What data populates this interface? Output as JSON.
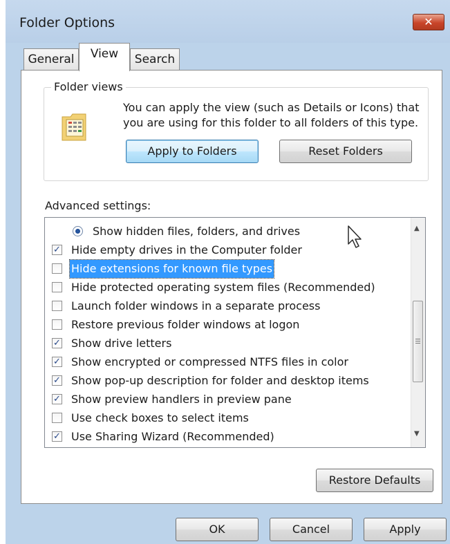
{
  "window": {
    "title": "Folder Options",
    "close_glyph": "✕"
  },
  "tabs": [
    {
      "label": "General",
      "active": false
    },
    {
      "label": "View",
      "active": true
    },
    {
      "label": "Search",
      "active": false
    }
  ],
  "folder_views": {
    "legend": "Folder views",
    "description": "You can apply the view (such as Details or Icons) that you are using for this folder to all folders of this type.",
    "icon": "folder-view-icon",
    "apply_button": "Apply to Folders",
    "reset_button": "Reset Folders"
  },
  "advanced": {
    "label": "Advanced settings:",
    "items": [
      {
        "type": "radio",
        "checked": true,
        "label": "Show hidden files, folders, and drives"
      },
      {
        "type": "checkbox",
        "checked": true,
        "label": "Hide empty drives in the Computer folder"
      },
      {
        "type": "checkbox",
        "checked": false,
        "selected": true,
        "label": "Hide extensions for known file types"
      },
      {
        "type": "checkbox",
        "checked": false,
        "label": "Hide protected operating system files (Recommended)"
      },
      {
        "type": "checkbox",
        "checked": false,
        "label": "Launch folder windows in a separate process"
      },
      {
        "type": "checkbox",
        "checked": false,
        "label": "Restore previous folder windows at logon"
      },
      {
        "type": "checkbox",
        "checked": true,
        "label": "Show drive letters"
      },
      {
        "type": "checkbox",
        "checked": true,
        "label": "Show encrypted or compressed NTFS files in color"
      },
      {
        "type": "checkbox",
        "checked": true,
        "label": "Show pop-up description for folder and desktop items"
      },
      {
        "type": "checkbox",
        "checked": true,
        "label": "Show preview handlers in preview pane"
      },
      {
        "type": "checkbox",
        "checked": false,
        "label": "Use check boxes to select items"
      },
      {
        "type": "checkbox",
        "checked": true,
        "label": "Use Sharing Wizard (Recommended)"
      }
    ],
    "check_glyph": "✓",
    "restore_button": "Restore Defaults"
  },
  "footer": {
    "ok": "OK",
    "cancel": "Cancel",
    "apply": "Apply"
  },
  "colors": {
    "selection": "#3399ff",
    "title_bg": "#bcd3ea",
    "close": "#c9452a"
  }
}
